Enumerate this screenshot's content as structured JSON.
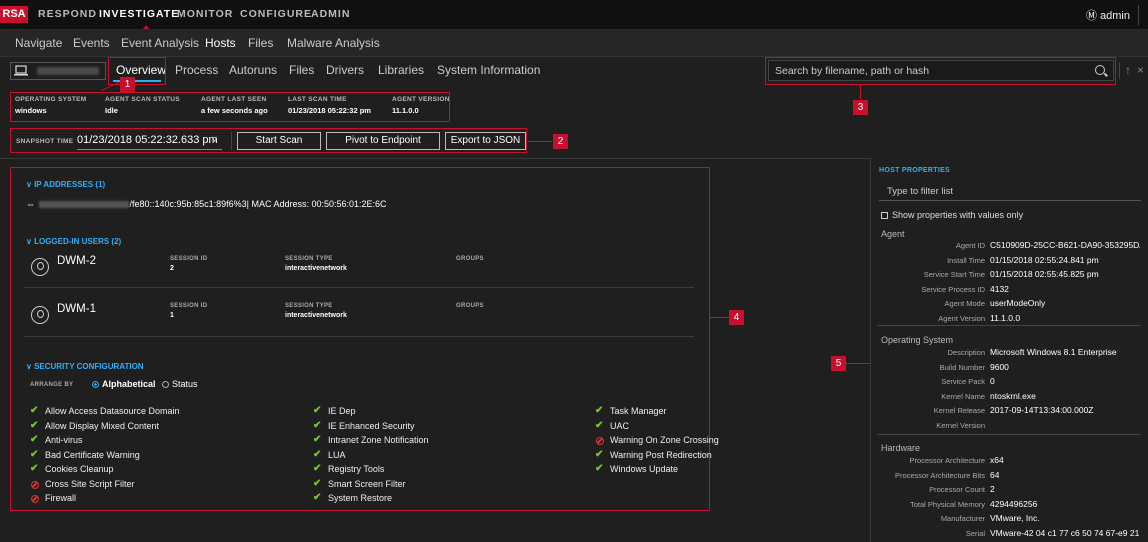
{
  "topbar": {
    "logo": "RSA",
    "nav": [
      "RESPOND",
      "INVESTIGATE",
      "MONITOR",
      "CONFIGURE",
      "ADMIN"
    ],
    "active": "INVESTIGATE",
    "user": "admin"
  },
  "subnav": [
    "Navigate",
    "Events",
    "Event Analysis",
    "Hosts",
    "Files",
    "Malware Analysis"
  ],
  "tabs": [
    "Overview",
    "Process",
    "Autoruns",
    "Files",
    "Drivers",
    "Libraries",
    "System Information"
  ],
  "search": {
    "placeholder": "Search by filename, path or hash"
  },
  "host_info": {
    "os_label": "OPERATING SYSTEM",
    "os_value": "windows",
    "scan_status_label": "AGENT SCAN STATUS",
    "scan_status_value": "Idle",
    "last_seen_label": "AGENT LAST SEEN",
    "last_seen_value": "a few seconds ago",
    "last_scan_label": "LAST SCAN TIME",
    "last_scan_value": "01/23/2018 05:22:32 pm",
    "agent_version_label": "AGENT VERSION",
    "agent_version_value": "11.1.0.0"
  },
  "snapshot": {
    "label": "SNAPSHOT TIME",
    "value": "01/23/2018 05:22:32.633 pm",
    "start_scan": "Start Scan",
    "pivot": "Pivot to Endpoint",
    "export": "Export to JSON"
  },
  "callouts": [
    "1",
    "2",
    "3",
    "4",
    "5"
  ],
  "ip": {
    "title": "IP ADDRESSES (1)",
    "value": "/fe80::140c:95b:85c1:89f6%3| MAC Address: 00:50:56:01:2E:6C"
  },
  "logged_users": {
    "title": "LOGGED-IN USERS (2)",
    "session_id_label": "SESSION ID",
    "session_type_label": "SESSION TYPE",
    "groups_label": "GROUPS",
    "users": [
      {
        "name": "DWM-2",
        "session_id": "2",
        "session_type": "interactivenetwork"
      },
      {
        "name": "DWM-1",
        "session_id": "1",
        "session_type": "interactivenetwork"
      }
    ]
  },
  "security": {
    "title": "SECURITY CONFIGURATION",
    "arrange_by": "ARRANGE BY",
    "opt_alpha": "Alphabetical",
    "opt_status": "Status",
    "col1": [
      {
        "label": "Allow Access Datasource Domain",
        "ok": true
      },
      {
        "label": "Allow Display Mixed Content",
        "ok": true
      },
      {
        "label": "Anti-virus",
        "ok": true
      },
      {
        "label": "Bad Certificate Warning",
        "ok": true
      },
      {
        "label": "Cookies Cleanup",
        "ok": true
      },
      {
        "label": "Cross Site Script Filter",
        "ok": false
      },
      {
        "label": "Firewall",
        "ok": false
      }
    ],
    "col2": [
      {
        "label": "IE Dep",
        "ok": true
      },
      {
        "label": "IE Enhanced Security",
        "ok": true
      },
      {
        "label": "Intranet Zone Notification",
        "ok": true
      },
      {
        "label": "LUA",
        "ok": true
      },
      {
        "label": "Registry Tools",
        "ok": true
      },
      {
        "label": "Smart Screen Filter",
        "ok": true
      },
      {
        "label": "System Restore",
        "ok": true
      }
    ],
    "col3": [
      {
        "label": "Task Manager",
        "ok": true
      },
      {
        "label": "UAC",
        "ok": true
      },
      {
        "label": "Warning On Zone Crossing",
        "ok": false
      },
      {
        "label": "Warning Post Redirection",
        "ok": true
      },
      {
        "label": "Windows Update",
        "ok": true
      }
    ]
  },
  "host_properties": {
    "title": "HOST PROPERTIES",
    "filter_placeholder": "Type to filter list",
    "show_only": "Show properties with values only",
    "agent_group": "Agent",
    "agent": [
      [
        "Agent ID",
        "C510909D-25CC-B621-DA90-353295DA..."
      ],
      [
        "Install Time",
        "01/15/2018 02:55:24.841 pm"
      ],
      [
        "Service Start Time",
        "01/15/2018 02:55:45.825 pm"
      ],
      [
        "Service Process ID",
        "4132"
      ],
      [
        "Agent Mode",
        "userModeOnly"
      ],
      [
        "Agent Version",
        "11.1.0.0"
      ]
    ],
    "os_group": "Operating System",
    "os": [
      [
        "Description",
        "Microsoft Windows 8.1 Enterprise"
      ],
      [
        "Build Number",
        "9600"
      ],
      [
        "Service Pack",
        "0"
      ],
      [
        "Kernel Name",
        "ntoskrnl.exe"
      ],
      [
        "Kernel Release",
        "2017-09-14T13:34:00.000Z"
      ],
      [
        "Kernel Version",
        ""
      ]
    ],
    "hw_group": "Hardware",
    "hw": [
      [
        "Processor Architecture",
        "x64"
      ],
      [
        "Processor Architecture Bits",
        "64"
      ],
      [
        "Processor Count",
        "2"
      ],
      [
        "Total Physical Memory",
        "4294496256"
      ],
      [
        "Manufacturer",
        "VMware, Inc."
      ],
      [
        "Serial",
        "VMware-42 04 c1 77 c6 50 74 67-e9 21 ..."
      ]
    ]
  }
}
